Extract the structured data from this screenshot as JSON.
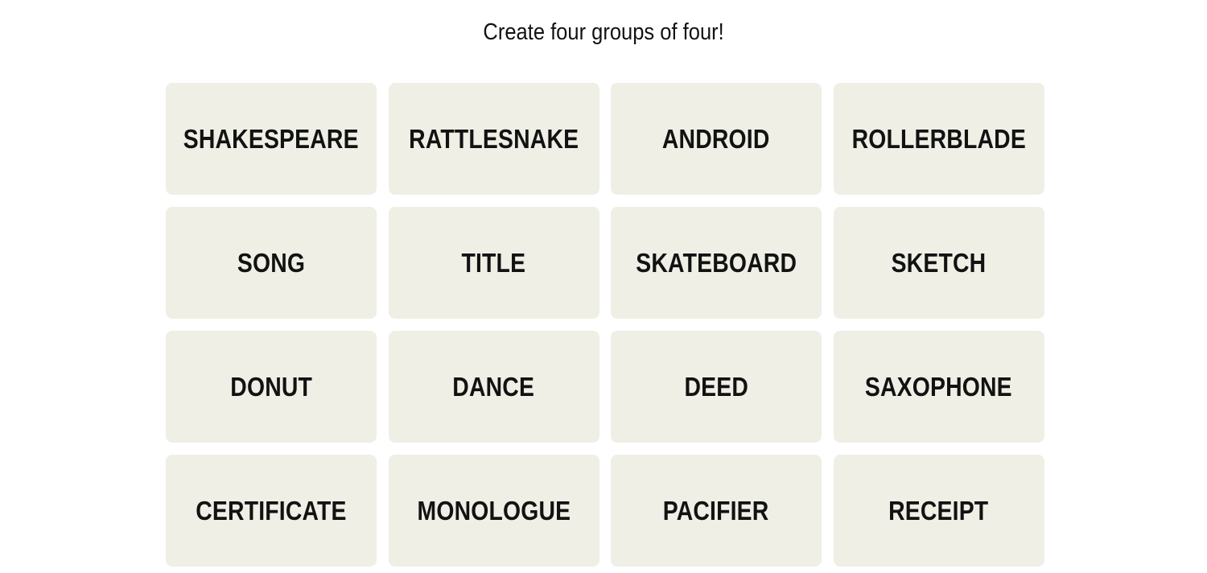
{
  "instructions": "Create four groups of four!",
  "tiles": [
    "SHAKESPEARE",
    "RATTLESNAKE",
    "ANDROID",
    "ROLLERBLADE",
    "SONG",
    "TITLE",
    "SKATEBOARD",
    "SKETCH",
    "DONUT",
    "DANCE",
    "DEED",
    "SAXOPHONE",
    "CERTIFICATE",
    "MONOLOGUE",
    "PACIFIER",
    "RECEIPT"
  ],
  "colors": {
    "tile_bg": "#efefe6",
    "text": "#121212"
  }
}
